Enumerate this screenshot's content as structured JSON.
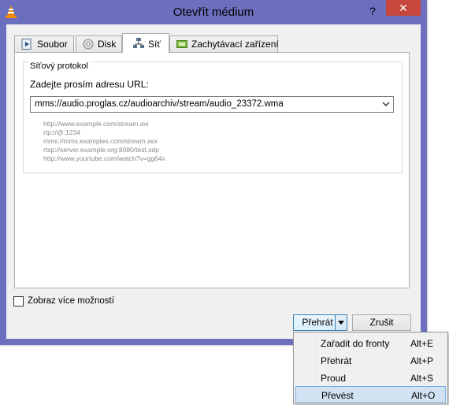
{
  "window": {
    "title": "Otevřít médium",
    "help": "?",
    "close": "✕",
    "icon": "vlc-cone-icon"
  },
  "tabs": [
    {
      "label": "Soubor",
      "icon": "file-play-icon",
      "active": false
    },
    {
      "label": "Disk",
      "icon": "disc-icon",
      "active": false
    },
    {
      "label": "Síť",
      "icon": "network-icon",
      "active": true
    },
    {
      "label": "Zachytávací zařízení",
      "icon": "capture-device-icon",
      "active": false
    }
  ],
  "network": {
    "group_title": "Síťový protokol",
    "url_label": "Zadejte prosím adresu URL:",
    "url_value": "mms://audio.proglas.cz/audioarchiv/stream/audio_23372.wma",
    "examples": [
      "http://www.example.com/stream.avi",
      "rtp://@:1234",
      "mms://mms.examples.com/stream.asx",
      "rtsp://server.example.org:8080/test.sdp",
      "http://www.yourtube.com/watch?v=gg64x"
    ]
  },
  "options": {
    "more_options_label": "Zobraz více možností",
    "checked": false
  },
  "buttons": {
    "play": "Přehrát",
    "cancel": "Zrušit"
  },
  "menu": {
    "items": [
      {
        "label": "Zařadit do fronty",
        "shortcut": "Alt+E",
        "selected": false
      },
      {
        "label": "Přehrát",
        "shortcut": "Alt+P",
        "selected": false
      },
      {
        "label": "Proud",
        "shortcut": "Alt+S",
        "selected": false
      },
      {
        "label": "Převést",
        "shortcut": "Alt+O",
        "selected": true
      }
    ]
  },
  "colors": {
    "window_frame": "#6c6fbd",
    "close_button": "#c7473c",
    "menu_highlight": "#d1e2f2"
  }
}
